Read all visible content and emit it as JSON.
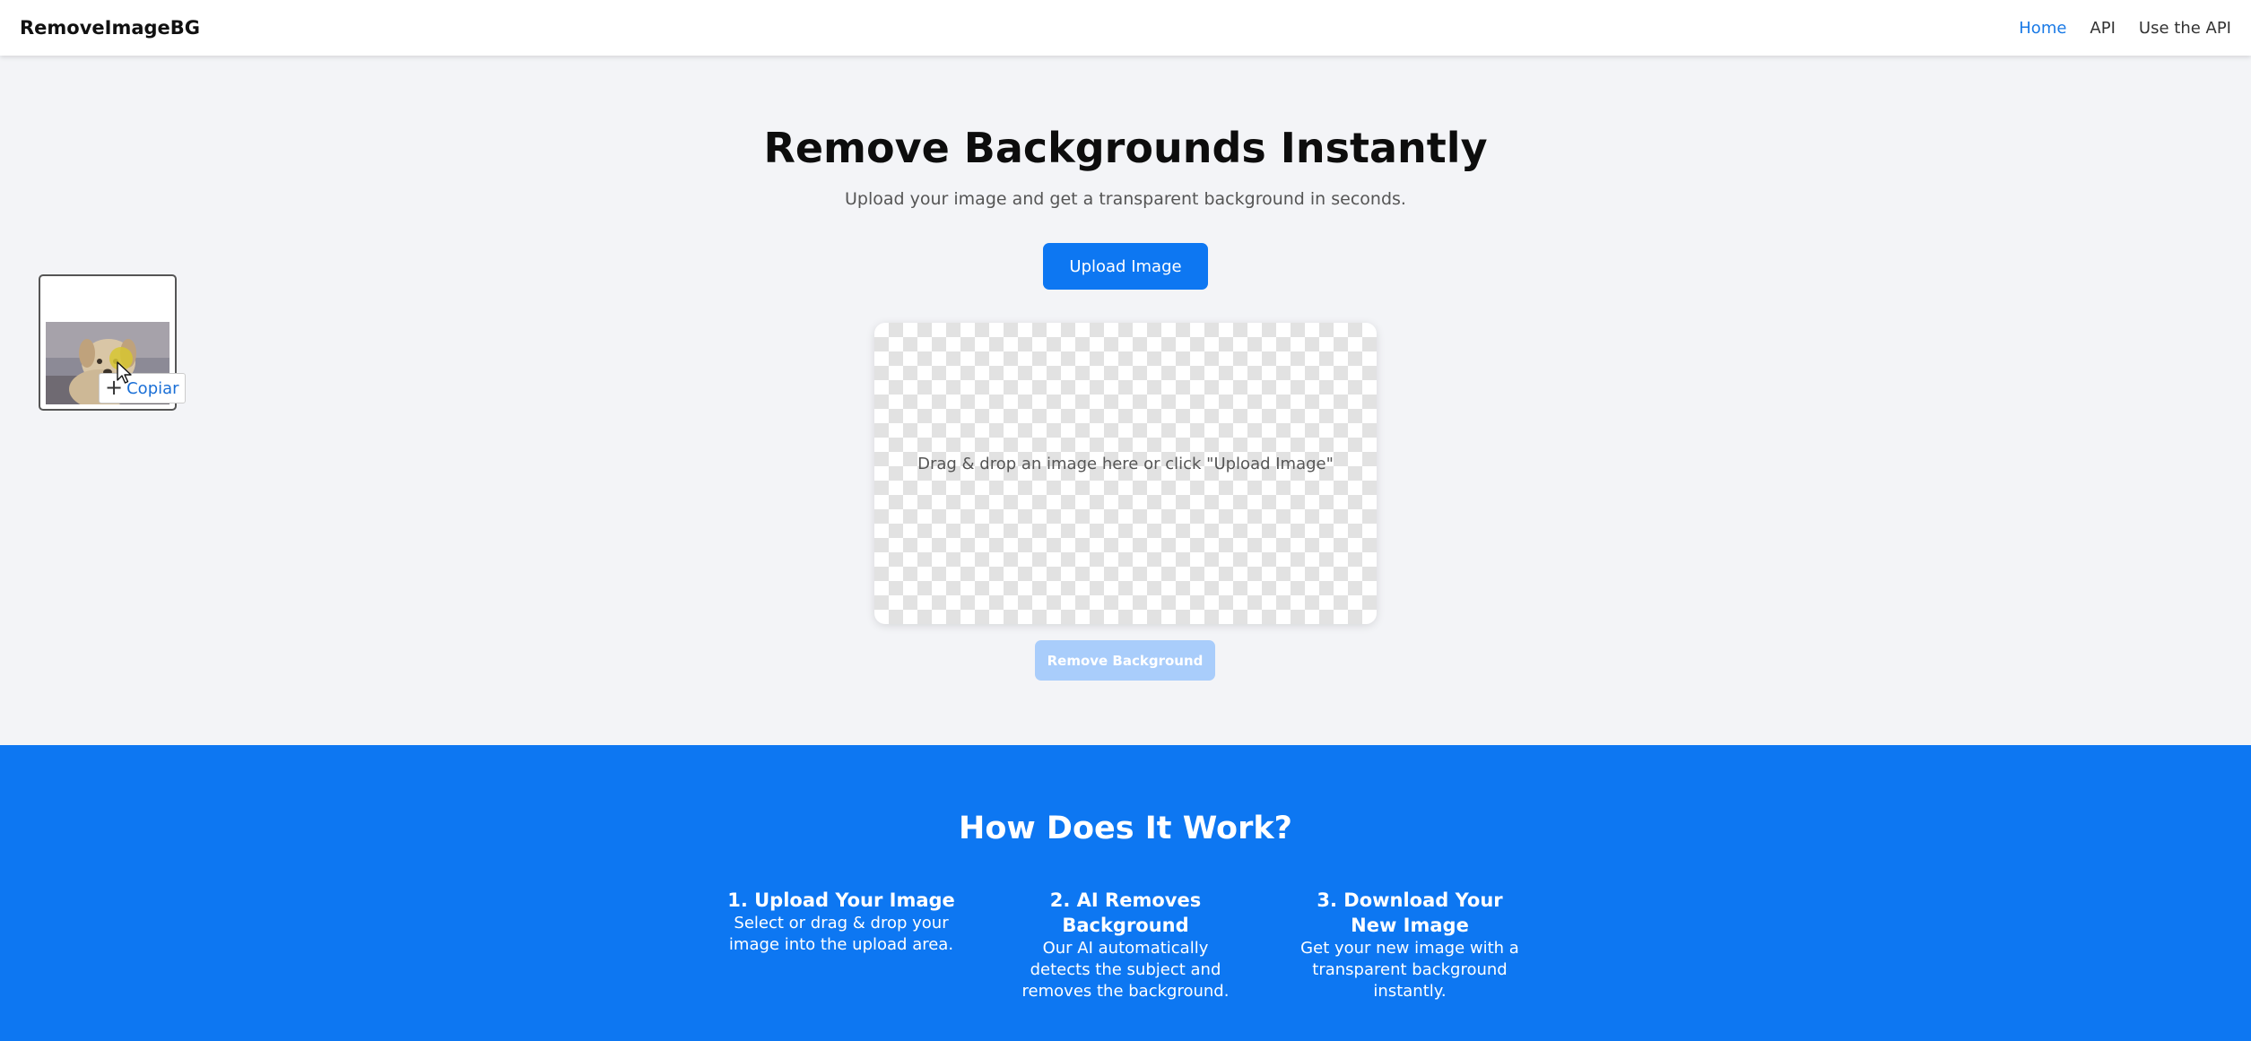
{
  "navbar": {
    "brand": "RemoveImageBG",
    "links": [
      {
        "label": "Home",
        "active": true
      },
      {
        "label": "API",
        "active": false
      },
      {
        "label": "Use the API",
        "active": false
      }
    ]
  },
  "hero": {
    "title": "Remove Backgrounds Instantly",
    "subtitle": "Upload your image and get a transparent background in seconds.",
    "upload_button": "Upload Image",
    "dropzone_text": "Drag & drop an image here or click \"Upload Image\"",
    "remove_button": "Remove Background"
  },
  "drag_overlay": {
    "tooltip_icon": "plus-icon",
    "tooltip_label": "Copiar",
    "cursor_icon": "arrow-cursor-icon"
  },
  "how": {
    "title": "How Does It Work?",
    "steps": [
      {
        "title": "1. Upload Your Image",
        "desc": "Select or drag & drop your image into the upload area."
      },
      {
        "title": "2. AI Removes Background",
        "desc": "Our AI automatically detects the subject and removes the background."
      },
      {
        "title": "3. Download Your New Image",
        "desc": "Get your new image with a transparent background instantly."
      }
    ]
  },
  "colors": {
    "primary": "#0d77f2",
    "primary_disabled": "#a9cdfb",
    "nav_active": "#1a7ae6",
    "page_bg": "#f3f4f7"
  }
}
